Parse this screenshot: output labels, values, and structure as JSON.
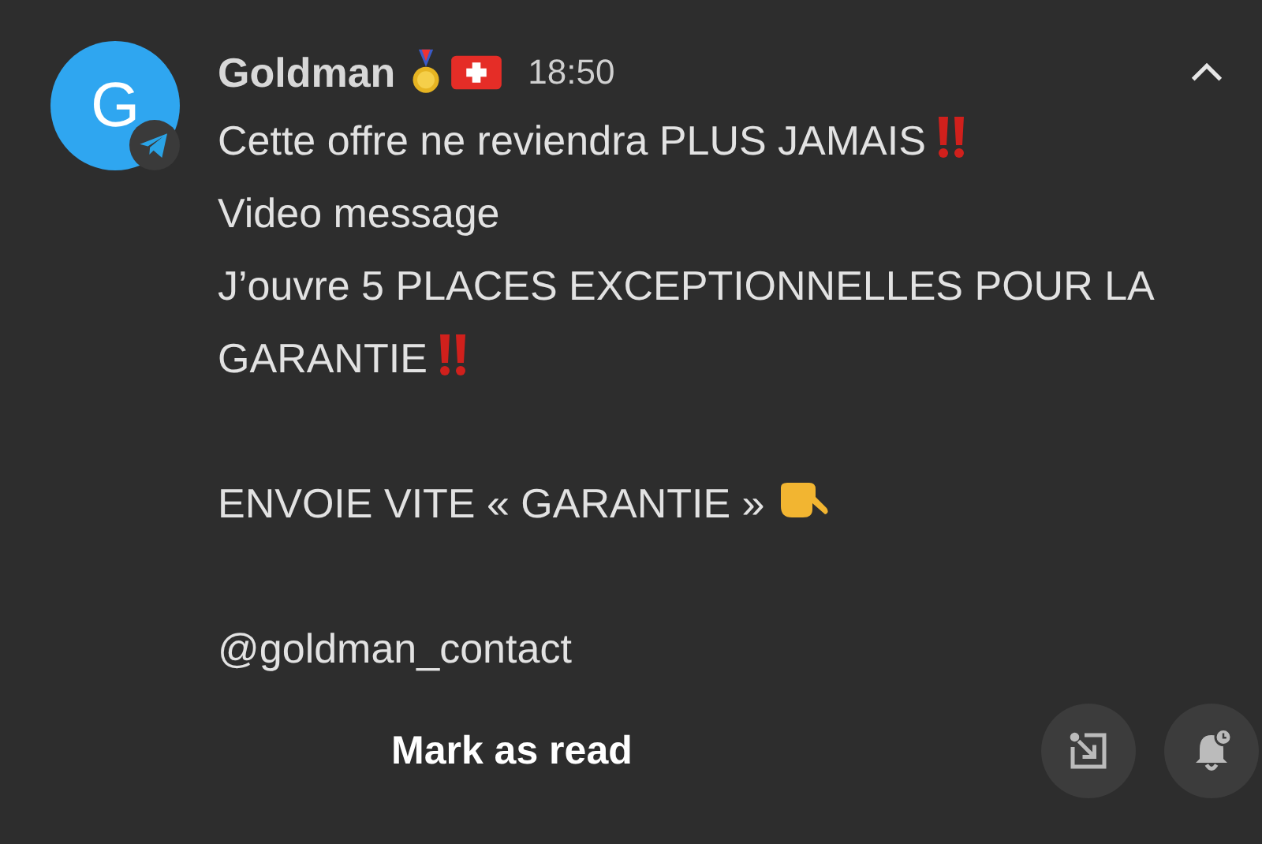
{
  "notification": {
    "avatar_letter": "G",
    "sender": "Goldman",
    "time": "18:50",
    "expanded": true,
    "paragraphs": [
      [
        {
          "text": "Cette offre ne reviendra PLUS JAMAIS",
          "kind": "alert"
        },
        {
          "text": "Video message",
          "kind": "plain"
        },
        {
          "text": "J’ouvre 5 PLACES EXCEPTIONNELLES POUR LA",
          "kind": "plain"
        },
        {
          "text": "GARANTIE",
          "kind": "alert"
        }
      ],
      [
        {
          "text": "ENVOIE VITE « GARANTIE »",
          "kind": "pointer"
        }
      ],
      [
        {
          "text": "@goldman_contact",
          "kind": "plain"
        }
      ]
    ],
    "action": "Mark as read"
  }
}
